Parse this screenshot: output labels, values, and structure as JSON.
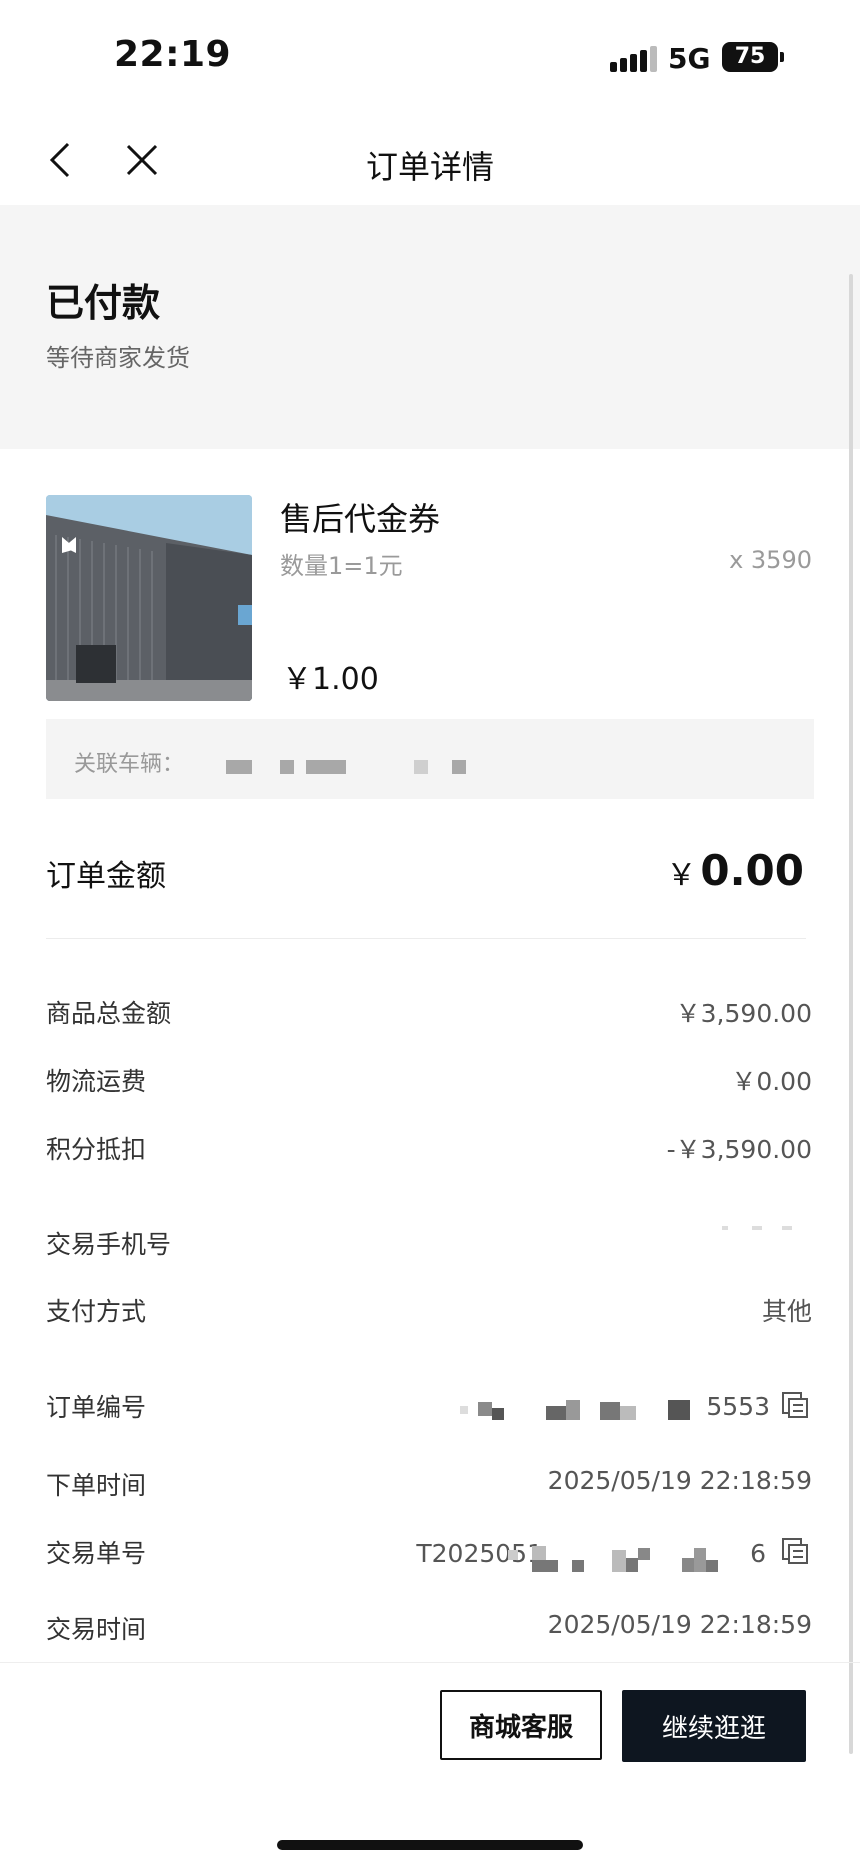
{
  "status_bar": {
    "time": "22:19",
    "network": "5G",
    "battery": "75"
  },
  "nav": {
    "title": "订单详情"
  },
  "order_status": {
    "title": "已付款",
    "subtitle": "等待商家发货"
  },
  "product": {
    "name": "售后代金券",
    "spec": "数量1=1元",
    "quantity": "x 3590",
    "price": "￥1.00",
    "image_logo_text": "小鹏"
  },
  "vehicle": {
    "label": "关联车辆："
  },
  "order_amount": {
    "label": "订单金额",
    "symbol": "￥",
    "value": "0.00"
  },
  "summary": {
    "goods_total_label": "商品总金额",
    "goods_total_value": "￥3,590.00",
    "shipping_label": "物流运费",
    "shipping_value": "￥0.00",
    "points_label": "积分抵扣",
    "points_value": "-￥3,590.00"
  },
  "details": {
    "phone_label": "交易手机号",
    "payment_label": "支付方式",
    "payment_value": "其他",
    "order_no_label": "订单编号",
    "order_no_suffix": "5553",
    "order_time_label": "下单时间",
    "order_time_value": "2025/05/19 22:18:59",
    "txn_no_label": "交易单号",
    "txn_no_prefix": "T2025051",
    "txn_no_suffix": "6",
    "txn_time_label": "交易时间",
    "txn_time_value": "2025/05/19 22:18:59"
  },
  "actions": {
    "service": "商城客服",
    "continue": "继续逛逛"
  },
  "icons": [
    "back-icon",
    "close-icon",
    "copy-icon"
  ]
}
